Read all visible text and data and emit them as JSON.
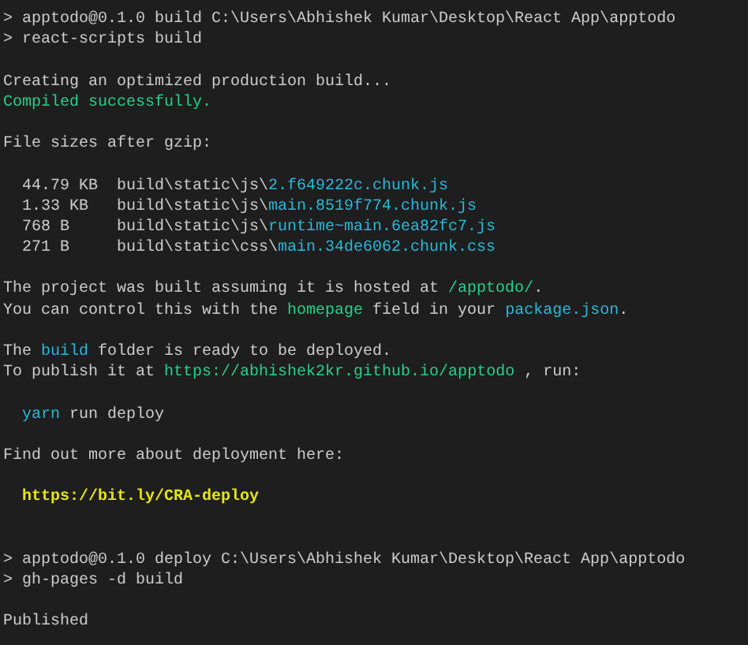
{
  "terminal": {
    "lines": [
      {
        "kind": "text",
        "segments": [
          {
            "kind": "plain",
            "text": "> apptodo@0.1.0 build C:\\Users\\Abhishek Kumar\\Desktop\\React App\\apptodo"
          }
        ]
      },
      {
        "kind": "text",
        "segments": [
          {
            "kind": "plain",
            "text": "> react-scripts build"
          }
        ]
      },
      {
        "kind": "blank"
      },
      {
        "kind": "text",
        "segments": [
          {
            "kind": "plain",
            "text": "Creating an optimized production build..."
          }
        ]
      },
      {
        "kind": "text",
        "segments": [
          {
            "kind": "success",
            "text": "Compiled successfully."
          }
        ]
      },
      {
        "kind": "blank"
      },
      {
        "kind": "text",
        "segments": [
          {
            "kind": "plain",
            "text": "File sizes after gzip:"
          }
        ]
      },
      {
        "kind": "blank"
      },
      {
        "kind": "text",
        "indented": true,
        "segments": [
          {
            "kind": "plain",
            "text": "44.79 KB  build\\static\\js\\"
          },
          {
            "kind": "file",
            "text": "2.f649222c.chunk.js"
          }
        ]
      },
      {
        "kind": "text",
        "indented": true,
        "segments": [
          {
            "kind": "plain",
            "text": "1.33 KB   build\\static\\js\\"
          },
          {
            "kind": "file",
            "text": "main.8519f774.chunk.js"
          }
        ]
      },
      {
        "kind": "text",
        "indented": true,
        "segments": [
          {
            "kind": "plain",
            "text": "768 B     build\\static\\js\\"
          },
          {
            "kind": "file",
            "text": "runtime~main.6ea82fc7.js"
          }
        ]
      },
      {
        "kind": "text",
        "indented": true,
        "segments": [
          {
            "kind": "plain",
            "text": "271 B     build\\static\\css\\"
          },
          {
            "kind": "file",
            "text": "main.34de6062.chunk.css"
          }
        ]
      },
      {
        "kind": "blank"
      },
      {
        "kind": "text",
        "segments": [
          {
            "kind": "plain",
            "text": "The project was built assuming it is hosted at "
          },
          {
            "kind": "success",
            "text": "/apptodo/"
          },
          {
            "kind": "plain",
            "text": "."
          }
        ]
      },
      {
        "kind": "text",
        "segments": [
          {
            "kind": "plain",
            "text": "You can control this with the "
          },
          {
            "kind": "success",
            "text": "homepage"
          },
          {
            "kind": "plain",
            "text": " field in your "
          },
          {
            "kind": "file",
            "text": "package.json"
          },
          {
            "kind": "plain",
            "text": "."
          }
        ]
      },
      {
        "kind": "blank"
      },
      {
        "kind": "text",
        "segments": [
          {
            "kind": "plain",
            "text": "The "
          },
          {
            "kind": "file",
            "text": "build"
          },
          {
            "kind": "plain",
            "text": " folder is ready to be deployed."
          }
        ]
      },
      {
        "kind": "text",
        "segments": [
          {
            "kind": "plain",
            "text": "To publish it at "
          },
          {
            "kind": "success",
            "text": "https://abhishek2kr.github.io/apptodo"
          },
          {
            "kind": "plain",
            "text": " , run:"
          }
        ]
      },
      {
        "kind": "blank"
      },
      {
        "kind": "text",
        "indented": true,
        "segments": [
          {
            "kind": "file",
            "text": "yarn"
          },
          {
            "kind": "plain",
            "text": " run deploy"
          }
        ]
      },
      {
        "kind": "blank"
      },
      {
        "kind": "text",
        "segments": [
          {
            "kind": "plain",
            "text": "Find out more about deployment here:"
          }
        ]
      },
      {
        "kind": "blank"
      },
      {
        "kind": "text",
        "indented": true,
        "segments": [
          {
            "kind": "link",
            "text": "https://bit.ly/CRA-deploy"
          }
        ]
      },
      {
        "kind": "blank"
      },
      {
        "kind": "blank"
      },
      {
        "kind": "text",
        "segments": [
          {
            "kind": "plain",
            "text": "> apptodo@0.1.0 deploy C:\\Users\\Abhishek Kumar\\Desktop\\React App\\apptodo"
          }
        ]
      },
      {
        "kind": "text",
        "segments": [
          {
            "kind": "plain",
            "text": "> gh-pages -d build"
          }
        ]
      },
      {
        "kind": "blank"
      },
      {
        "kind": "text",
        "segments": [
          {
            "kind": "plain",
            "text": "Published"
          }
        ]
      }
    ]
  }
}
